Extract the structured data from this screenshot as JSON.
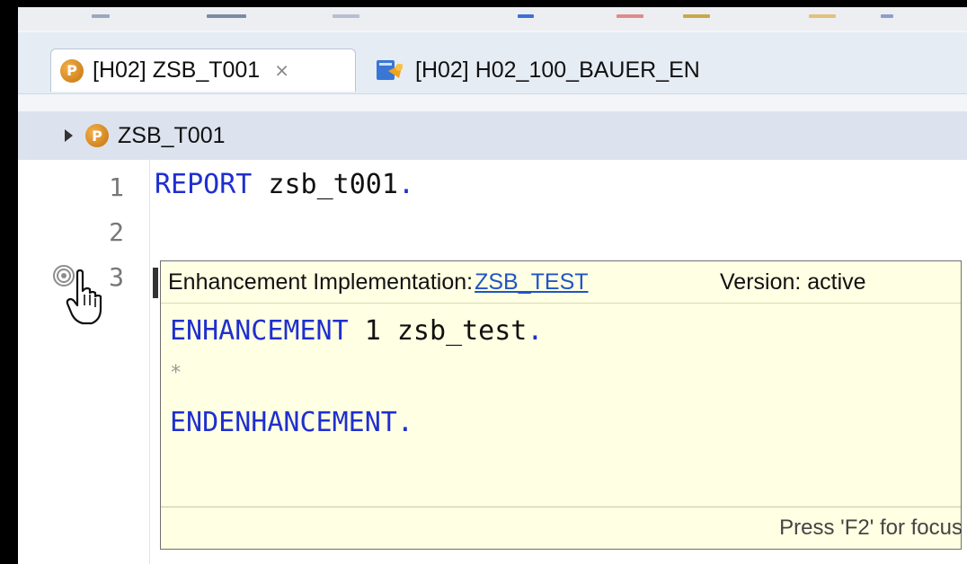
{
  "tabs": [
    {
      "label": "[H02] ZSB_T001",
      "icon": "abap-program-icon",
      "active": true
    },
    {
      "label": "[H02] H02_100_BAUER_EN",
      "icon": "enhancement-icon",
      "active": false
    }
  ],
  "breadcrumb": {
    "label": "ZSB_T001"
  },
  "icon_glyphs": {
    "program": "P",
    "close": "⨯"
  },
  "editor": {
    "lines": [
      {
        "number": "1",
        "keyword": "REPORT",
        "rest": " zsb_t001",
        "period": "."
      },
      {
        "number": "2"
      },
      {
        "number": "3"
      }
    ]
  },
  "popup": {
    "label": "Enhancement Implementation:",
    "link": "ZSB_TEST",
    "version": "Version: active",
    "code": {
      "line1_keyword": "ENHANCEMENT",
      "line1_rest": " 1 zsb_test",
      "line1_period": ".",
      "line2": "*",
      "line3_keyword": "ENDENHANCEMENT",
      "line3_period": "."
    },
    "footer": "Press 'F2' for focus"
  },
  "colors": {
    "keyword": "#1e2fcf",
    "popup_bg": "#ffffe3",
    "link": "#1f55c7"
  }
}
